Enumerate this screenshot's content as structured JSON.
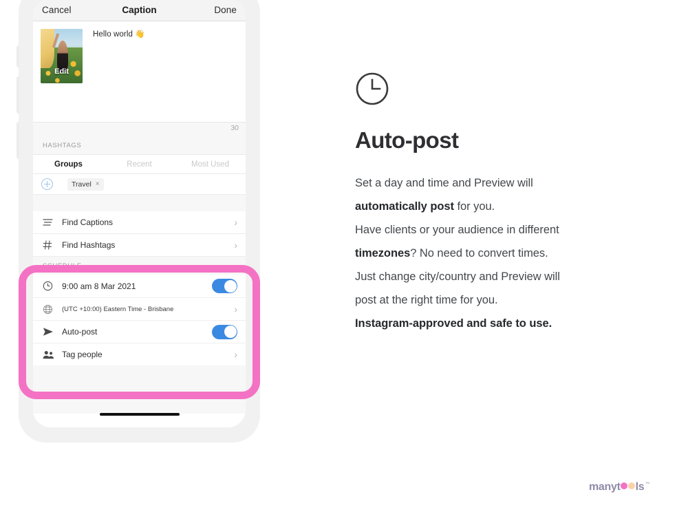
{
  "phone": {
    "navbar": {
      "cancel_label": "Cancel",
      "title": "Caption",
      "done_label": "Done"
    },
    "caption": {
      "thumb_overlay_label": "Edit",
      "text": "Hello world 👋",
      "char_counter": "30"
    },
    "hashtags": {
      "section_label": "HASHTAGS",
      "tabs": [
        {
          "label": "Groups",
          "active": true
        },
        {
          "label": "Recent",
          "active": false
        },
        {
          "label": "Most Used",
          "active": false
        }
      ],
      "chip": {
        "label": "Travel",
        "remove_glyph": "×"
      }
    },
    "find_rows": [
      {
        "icon": "text-lines-icon",
        "label": "Find Captions",
        "chevron": "›"
      },
      {
        "icon": "hash-icon",
        "label": "Find Hashtags",
        "chevron": "›"
      }
    ],
    "schedule": {
      "section_label": "SCHEDULE",
      "rows": [
        {
          "icon": "clock-icon",
          "label": "9:00 am  8 Mar 2021",
          "control": "toggle",
          "toggle_on": true
        },
        {
          "icon": "globe-icon",
          "label": "(UTC +10:00) Eastern Time - Brisbane",
          "control": "chevron",
          "chevron": "›"
        },
        {
          "icon": "send-icon",
          "label": "Auto-post",
          "control": "toggle",
          "toggle_on": true
        },
        {
          "icon": "people-icon",
          "label": "Tag people",
          "control": "chevron",
          "chevron": "›"
        }
      ]
    }
  },
  "panel": {
    "icon": "clock-icon",
    "title": "Auto-post",
    "lines": [
      {
        "id": "l1",
        "pre": "Set a day and time and Preview will",
        "bold": "",
        "post": ""
      },
      {
        "id": "l2",
        "pre": "",
        "bold": "automatically post",
        "post": " for you."
      },
      {
        "id": "l3",
        "pre": "Have clients or your audience in different",
        "bold": "",
        "post": ""
      },
      {
        "id": "l4",
        "pre": "",
        "bold": "timezones",
        "post": "? No need to convert times."
      },
      {
        "id": "l5",
        "pre": "Just change city/country and Preview will",
        "bold": "",
        "post": ""
      },
      {
        "id": "l6",
        "pre": "post at the right time for you.",
        "bold": "",
        "post": ""
      },
      {
        "id": "l7",
        "pre": "",
        "bold": "Instagram-approved and safe to use.",
        "post": ""
      }
    ]
  },
  "logo": {
    "part1": "many",
    "part2": "t",
    "part3": "ls",
    "tm": "™"
  },
  "colors": {
    "highlight_pink": "#f472c4",
    "toggle_blue": "#3b8ae2",
    "logo_text": "#8e8ba8",
    "logo_dot_pink": "#f472c4",
    "logo_dot_peach": "#fbd2a8"
  }
}
